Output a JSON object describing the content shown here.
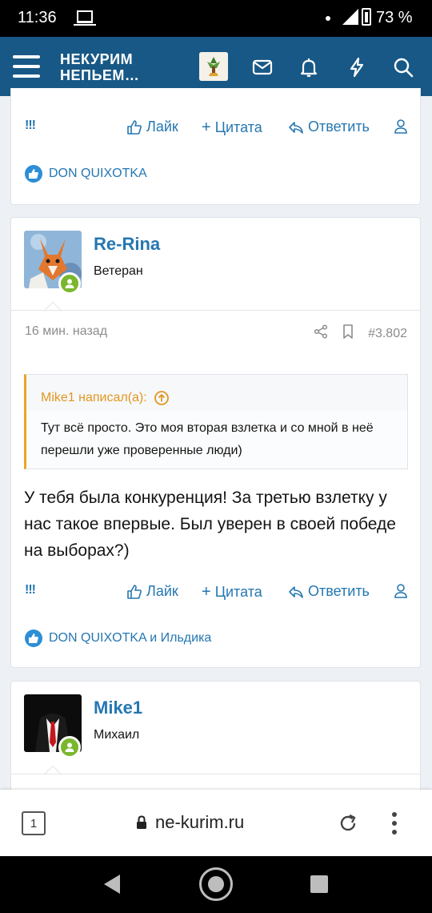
{
  "status_bar": {
    "time": "11:36",
    "battery": "73 %"
  },
  "header": {
    "logo_line1": "НЕКУРИМ",
    "logo_line2": "НЕПЬЕМ…",
    "icons": [
      "menu-icon",
      "avatar",
      "mail-icon",
      "bell-icon",
      "lightning-icon",
      "search-icon"
    ]
  },
  "post_top": {
    "actions": {
      "excl": "!!!",
      "like": "Лайк",
      "quote": "Цитата",
      "reply": "Ответить"
    },
    "reactions": "DON QUIXOTKA"
  },
  "post_main": {
    "username": "Re-Rina",
    "user_title": "Ветеран",
    "time": "16 мин. назад",
    "post_number": "#3.802",
    "quote": {
      "author": "Mike1 написал(а):",
      "text": "Тут всё просто. Это моя вторая взлетка и со мной в неё перешли уже проверенные люди)"
    },
    "message": "У тебя была конкуренция! За третью взлетку у нас такое впервые. Был уверен в своей победе на выборах?)",
    "actions": {
      "excl": "!!!",
      "like": "Лайк",
      "quote": "Цитата",
      "reply": "Ответить"
    },
    "reactions": "DON QUIXOTKA и Ильдика"
  },
  "post_next": {
    "username": "Mike1",
    "user_title": "Михаил"
  },
  "browser": {
    "tabs_count": "1",
    "url": "ne-kurim.ru"
  },
  "colors": {
    "header_bg": "#185886",
    "link": "#2577b1",
    "quote_accent": "#f0a228",
    "online": "#7ab72d"
  }
}
